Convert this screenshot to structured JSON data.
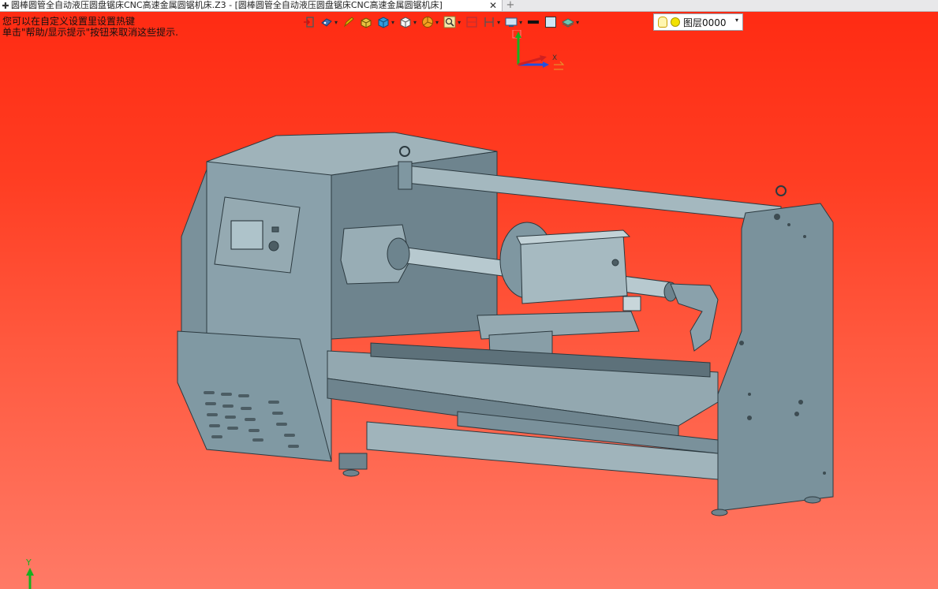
{
  "tab": {
    "title": "圆棒圆管全自动液压圆盘锯床CNC高速金属圆锯机床.Z3 - [圆棒圆管全自动液压圆盘锯床CNC高速金属圆锯机床]",
    "close_icon": "close-icon",
    "new_tab": "+"
  },
  "hint": {
    "line1": "您可以在自定义设置里设置热键",
    "line2": "单击\"帮助/显示提示\"按钮来取消这些提示."
  },
  "toolbar": {
    "items": [
      {
        "icon": "exit-icon"
      },
      {
        "icon": "view-palette-icon"
      },
      {
        "icon": "pencil-icon"
      },
      {
        "icon": "solid-box-icon"
      },
      {
        "icon": "cube-blue-icon"
      },
      {
        "icon": "cube-white-icon"
      },
      {
        "icon": "pie-render-icon"
      },
      {
        "icon": "zoom-icon"
      },
      {
        "icon": "section-icon"
      },
      {
        "icon": "frame-icon"
      },
      {
        "icon": "display-icon"
      },
      {
        "icon": "line-color-icon"
      },
      {
        "icon": "fill-color-icon"
      },
      {
        "icon": "layer-stack-icon"
      }
    ],
    "layer_label": "图层0000"
  },
  "triad": {
    "x_label": "X",
    "y_label": "Y",
    "z_label": "Z"
  },
  "corner_axis": {
    "y_label": "Y"
  },
  "colors": {
    "machine": "#7f97a1",
    "machine_dark": "#5b6f78",
    "machine_light": "#a9bcc3",
    "bg_top": "#ff2a12",
    "bg_bottom": "#ff7a66"
  }
}
